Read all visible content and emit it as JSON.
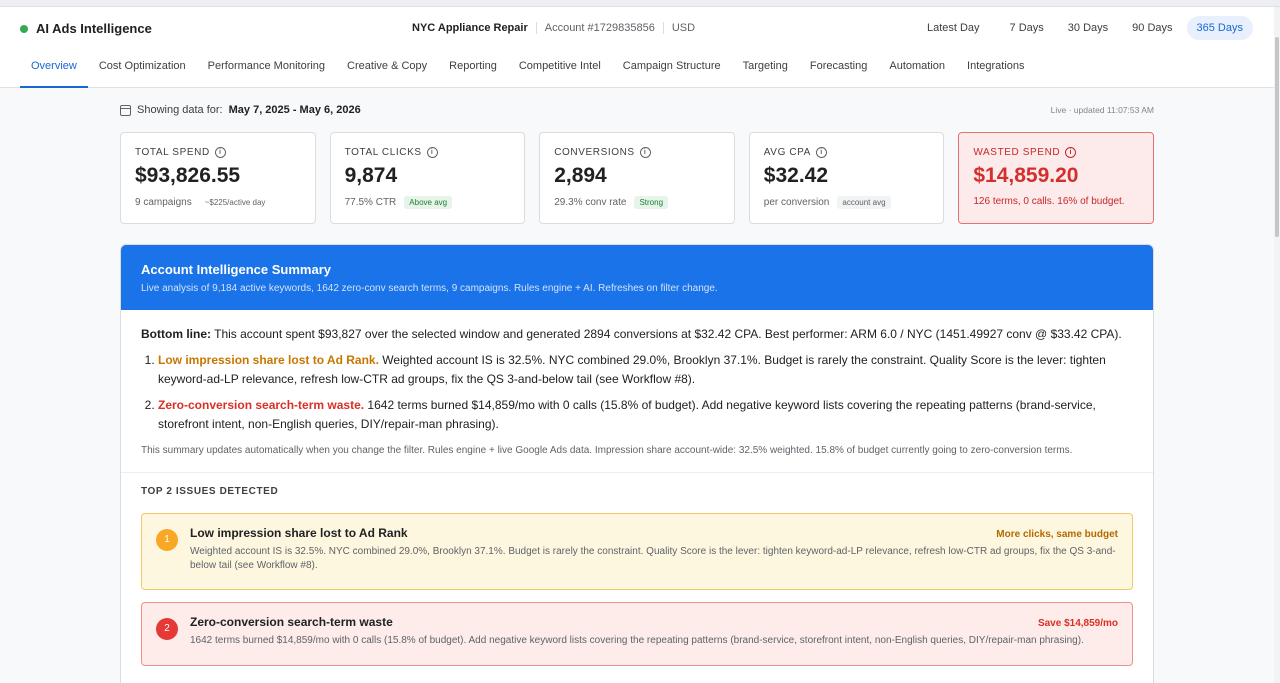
{
  "app": {
    "name": "AI Ads Intelligence"
  },
  "account": {
    "client": "NYC Appliance Repair",
    "account_id": "Account #1729835856",
    "currency": "USD"
  },
  "ranges": [
    {
      "label": "Latest Day"
    },
    {
      "label": "7 Days"
    },
    {
      "label": "30 Days"
    },
    {
      "label": "90 Days"
    },
    {
      "label": "365 Days"
    }
  ],
  "active_range": "365 Days",
  "tabs": [
    {
      "label": "Overview"
    },
    {
      "label": "Cost Optimization"
    },
    {
      "label": "Performance Monitoring"
    },
    {
      "label": "Creative & Copy"
    },
    {
      "label": "Reporting"
    },
    {
      "label": "Competitive Intel"
    },
    {
      "label": "Campaign Structure"
    },
    {
      "label": "Targeting"
    },
    {
      "label": "Forecasting"
    },
    {
      "label": "Automation"
    },
    {
      "label": "Integrations"
    }
  ],
  "active_tab": "Overview",
  "date_range": {
    "prefix": "Showing data for:",
    "dates": "May 7, 2025 - May 6, 2026"
  },
  "live_status": "Live · updated 11:07:53 AM",
  "kpis": [
    {
      "label": "TOTAL SPEND",
      "value": "$93,826.55",
      "sub": "9 campaigns",
      "badge": "~$225/active day",
      "badge_style": "plain"
    },
    {
      "label": "TOTAL CLICKS",
      "value": "9,874",
      "sub": "77.5% CTR",
      "badge": "Above avg",
      "badge_style": "green"
    },
    {
      "label": "CONVERSIONS",
      "value": "2,894",
      "sub": "29.3% conv rate",
      "badge": "Strong",
      "badge_style": "green"
    },
    {
      "label": "AVG CPA",
      "value": "$32.42",
      "sub": "per conversion",
      "badge": "account avg",
      "badge_style": "gray"
    }
  ],
  "wasted": {
    "label": "WASTED SPEND",
    "value": "$14,859.20",
    "sub": "126 terms, 0 calls. 16% of budget."
  },
  "summary": {
    "title": "Account Intelligence Summary",
    "description": "Live analysis of 9,184 active keywords, 1642 zero-conv search terms, 9 campaigns. Rules engine + AI. Refreshes on filter change.",
    "bottom_line_label": "Bottom line:",
    "bottom_line_text": "This account spent $93,827 over the selected window and generated 2894 conversions at $32.42 CPA. Best performer: ARM 6.0 / NYC (1451.49927 conv @ $33.42 CPA).",
    "findings": [
      {
        "title": "Low impression share lost to Ad Rank.",
        "text": "Weighted account IS is 32.5%. NYC combined 29.0%, Brooklyn 37.1%. Budget is rarely the constraint. Quality Score is the lever: tighten keyword-ad-LP relevance, refresh low-CTR ad groups, fix the QS 3-and-below tail (see Workflow #8)."
      },
      {
        "title": "Zero-conversion search-term waste.",
        "text": "1642 terms burned $14,859/mo with 0 calls (15.8% of budget). Add negative keyword lists covering the repeating patterns (brand-service, storefront intent, non-English queries, DIY/repair-man phrasing)."
      }
    ],
    "note": "This summary updates automatically when you change the filter. Rules engine + live Google Ads data. Impression share account-wide: 32.5% weighted. 15.8% of budget currently going to zero-conversion terms."
  },
  "issues": {
    "heading": "TOP 2 ISSUES DETECTED",
    "items": [
      {
        "number": "1",
        "title": "Low impression share lost to Ad Rank",
        "tag": "More clicks, same budget",
        "desc": "Weighted account IS is 32.5%. NYC combined 29.0%, Brooklyn 37.1%. Budget is rarely the constraint. Quality Score is the lever: tighten keyword-ad-LP relevance, refresh low-CTR ad groups, fix the QS 3-and-below tail (see Workflow #8)."
      },
      {
        "number": "2",
        "title": "Zero-conversion search-term waste",
        "tag": "Save $14,859/mo",
        "desc": "1642 terms burned $14,859/mo with 0 calls (15.8% of budget). Add negative keyword lists covering the repeating patterns (brand-service, storefront intent, non-English queries, DIY/repair-man phrasing)."
      }
    ]
  },
  "colors": {
    "accent": "#1a73e8",
    "success": "#34a853",
    "warning": "#f9a825",
    "danger": "#d93025"
  }
}
